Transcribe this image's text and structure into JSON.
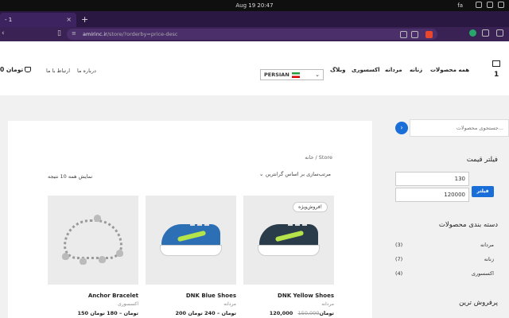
{
  "os": {
    "clock": "Aug 19  20:47",
    "lang": "fa"
  },
  "browser": {
    "tab_title": "- 1",
    "new_tab": "+",
    "url_host": "amirinc.ir",
    "url_path": "/store/?orderby=price-desc"
  },
  "header": {
    "cart": "0 تومان",
    "links": [
      "ارتباط با ما",
      "درباره ما"
    ],
    "language": "PERSIAN",
    "nav": [
      "همه محصولات",
      "زنانه",
      "مردانه",
      "اکسسوری",
      "وبلاگ"
    ],
    "logo_num": "1"
  },
  "main": {
    "breadcrumb": "خانه / Store",
    "sort_label": "مرتب‌سازی بر اساس گرانترین",
    "results": "نمایش همه 10 نتیجه",
    "products": [
      {
        "name": "DNK Yellow Shoes",
        "category": "مردانه",
        "price": "120,000 تومان",
        "old_price": "150,000",
        "badge": "فروش‌ویژه!"
      },
      {
        "name": "DNK Blue Shoes",
        "category": "مردانه",
        "price": "200 تومان – 240 تومان"
      },
      {
        "name": "Anchor Bracelet",
        "category": "اکسسوری",
        "price": "150 تومان – 180 تومان"
      }
    ]
  },
  "sidebar": {
    "search_placeholder": "جستجوی محصولات...",
    "search_btn": "›",
    "price_title": "فیلتر قیمت",
    "min_price": "130",
    "max_price": "120000",
    "filter_btn": "فیلتر",
    "cat_title": "دسته بندی محصولات",
    "categories": [
      {
        "label": "مردانه",
        "count": "(3)"
      },
      {
        "label": "زنانه",
        "count": "(7)"
      },
      {
        "label": "اکسسوری",
        "count": "(4)"
      }
    ],
    "bestsellers_title": "پرفروش ترین"
  }
}
